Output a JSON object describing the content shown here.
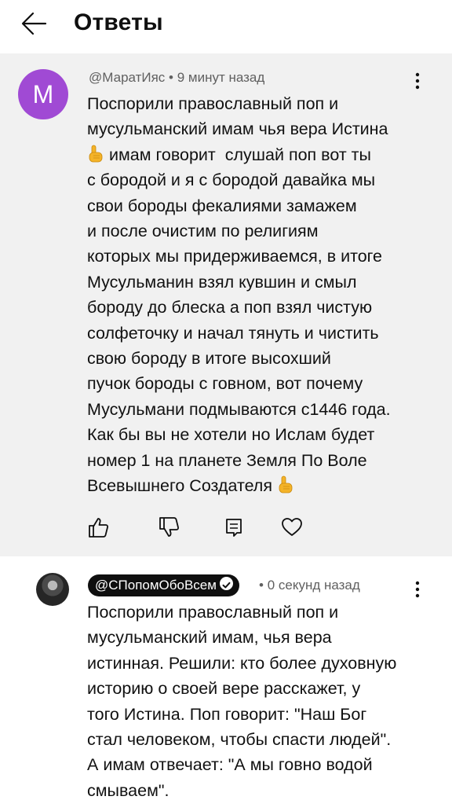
{
  "header": {
    "title": "Ответы"
  },
  "comment1": {
    "avatar_letter": "М",
    "author": "@МаратИяс",
    "separator": " • ",
    "time": "9 минут назад",
    "lines": [
      "Поспорили православный поп и",
      "мусульманский имам чья вера Истина",
      "имам говорит  слушай поп вот ты",
      "с бородой и я с бородой давайка мы",
      "свои бороды фекалиями замажем",
      "и после очистим по религиям",
      "которых мы придерживаемся, в итоге",
      "Мусульманин взял кувшин и смыл",
      "бороду до блеска а поп взял чистую",
      "солфеточку и начал тянуть и чистить",
      "свою бороду в итоге высохший",
      "пучок бороды с говном, вот почему",
      "Мусульмани подмываются с1446 года.",
      "Как бы вы не хотели но Ислам будет",
      "номер 1 на планете Земля По Воле",
      "Всевышнего Создателя"
    ],
    "emoji_icon": "index-finger-up-emoji",
    "actions": [
      "thumb-up-icon",
      "thumb-down-icon",
      "reply-icon",
      "heart-icon"
    ]
  },
  "comment2": {
    "author": "@СПопомОбоВсем",
    "separator": " • ",
    "time": "0 секунд назад",
    "lines": [
      "Поспорили православный поп и",
      "мусульманский имам, чья вера",
      "истинная. Решили: кто более духовную",
      "историю о своей вере расскажет, у",
      "того Истина. Поп говорит: \"Наш Бог",
      "стал человеком, чтобы спасти людей\".",
      "А имам отвечает: \"А мы говно водой",
      "смываем\"."
    ]
  },
  "colors": {
    "avatar_purple": "#a04ad4",
    "highlight_bg": "#f1f1f1",
    "meta_gray": "#606060",
    "chip_bg": "#0f0f0f"
  }
}
